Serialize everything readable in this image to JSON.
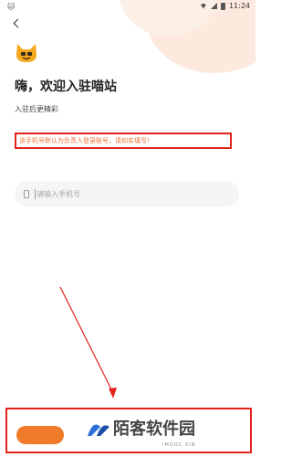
{
  "status_bar": {
    "time": "11:24",
    "left_icon": "app-icon"
  },
  "header": {
    "back_icon": "back-arrow-icon",
    "logo_icon": "cat-logo-icon"
  },
  "welcome": {
    "title": "嗨，欢迎入驻喵站",
    "subtitle": "入驻后更精彩"
  },
  "notice": {
    "text": "该手机号默认为负责人登录账号，请如实填写!"
  },
  "phone_field": {
    "placeholder": "请输入手机号",
    "icon": "phone-icon"
  },
  "colors": {
    "accent": "#f07b2a",
    "highlight": "#e2231a",
    "notice_text": "#f0753a"
  },
  "watermark": {
    "title": "陌客软件园",
    "subtitle": "IMOOC.XIN"
  }
}
